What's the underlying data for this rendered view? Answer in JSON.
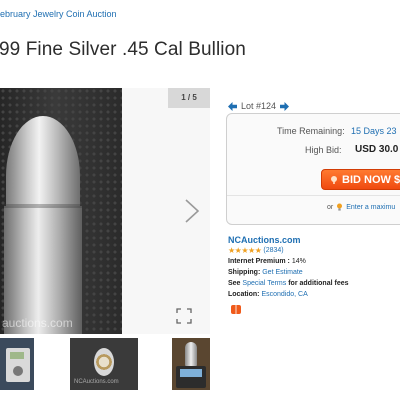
{
  "breadcrumb": "ebruary Jewelry Coin Auction",
  "title": "99 Fine Silver .45 Cal Bullion",
  "gallery": {
    "counter": "1 / 5",
    "watermark": "auctions.com",
    "thumb2_watermark": "NCAuctions.com"
  },
  "lot": {
    "label": "Lot #124"
  },
  "bid_box": {
    "time_label": "Time Remaining:",
    "time_value": "15 Days 23",
    "high_bid_label": "High Bid:",
    "high_bid_value": "USD 30.0",
    "bid_now_label": "BID NOW $3",
    "or_text": "or",
    "enter_max_label": "Enter a maximu"
  },
  "seller": {
    "name": "NCAuctions.com",
    "stars": "★★★★★",
    "rating_count": "(2834)"
  },
  "info": {
    "premium_label": "Internet Premium :",
    "premium_value": "14%",
    "shipping_label": "Shipping:",
    "shipping_value": "Get Estimate",
    "see_text": "See",
    "special_terms": "Special Terms",
    "additional_fees": "for additional fees",
    "location_label": "Location:",
    "location_value": "Escondido, CA"
  },
  "colors": {
    "link": "#1f6fb2",
    "bid_button": "#f04a10",
    "stars": "#f0a020"
  }
}
